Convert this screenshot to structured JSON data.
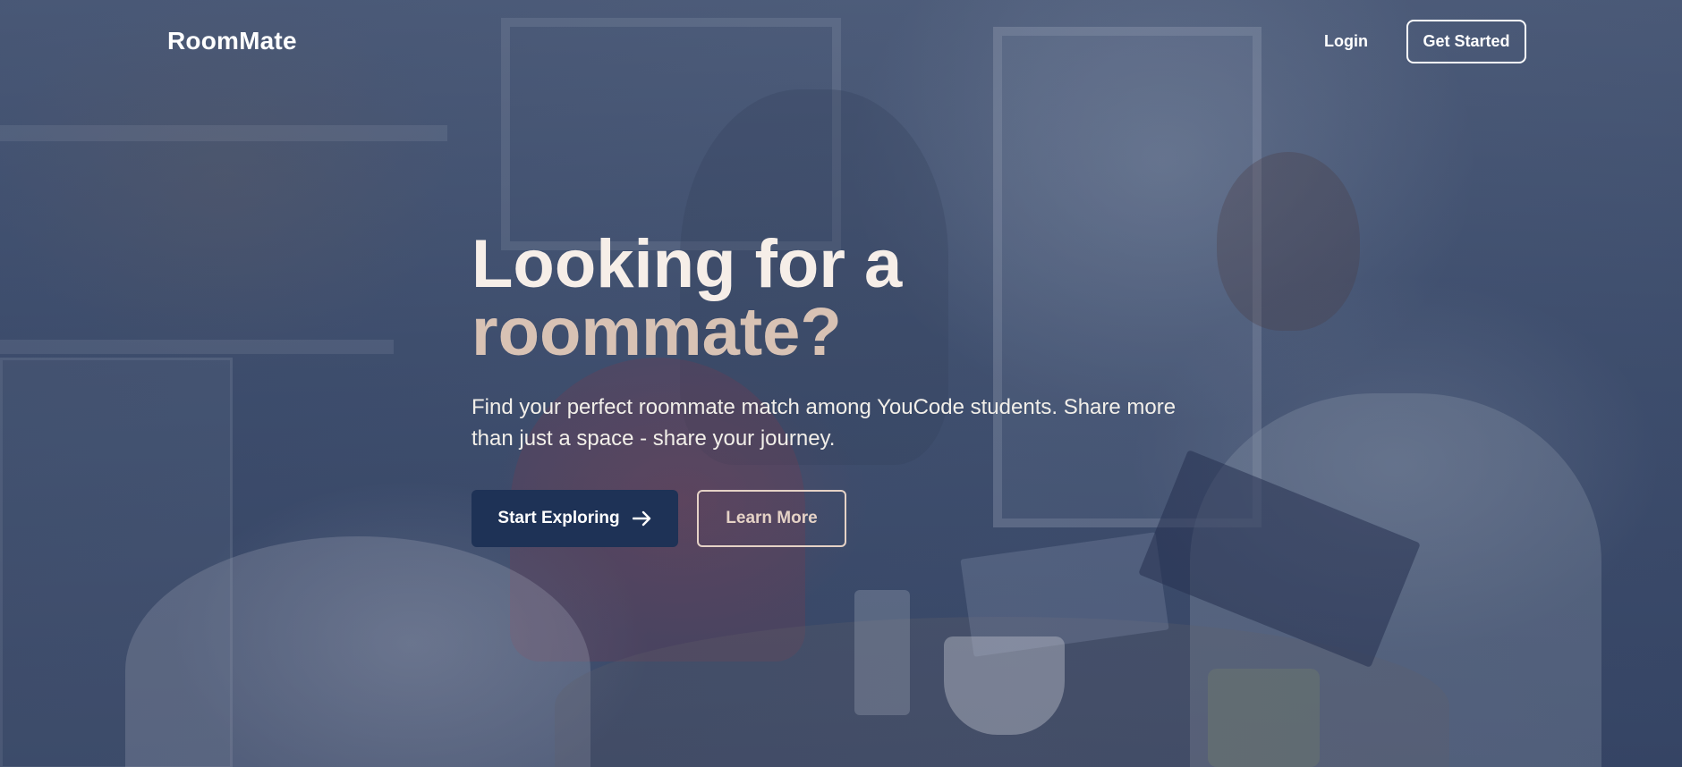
{
  "nav": {
    "brand": "RoomMate",
    "login_label": "Login",
    "get_started_label": "Get Started"
  },
  "hero": {
    "title_line1": "Looking for a",
    "title_line2": "roommate?",
    "subtitle": "Find your perfect roommate match among YouCode students. Share more than just a space - share your journey.",
    "primary_button_label": "Start Exploring",
    "primary_button_icon": "arrow-right-icon",
    "secondary_button_label": "Learn More"
  },
  "colors": {
    "title_primary": "#f6eee8",
    "title_accent": "#d8c2b4",
    "primary_button_bg": "#1e3256",
    "secondary_button_border": "#e5d2c6"
  }
}
